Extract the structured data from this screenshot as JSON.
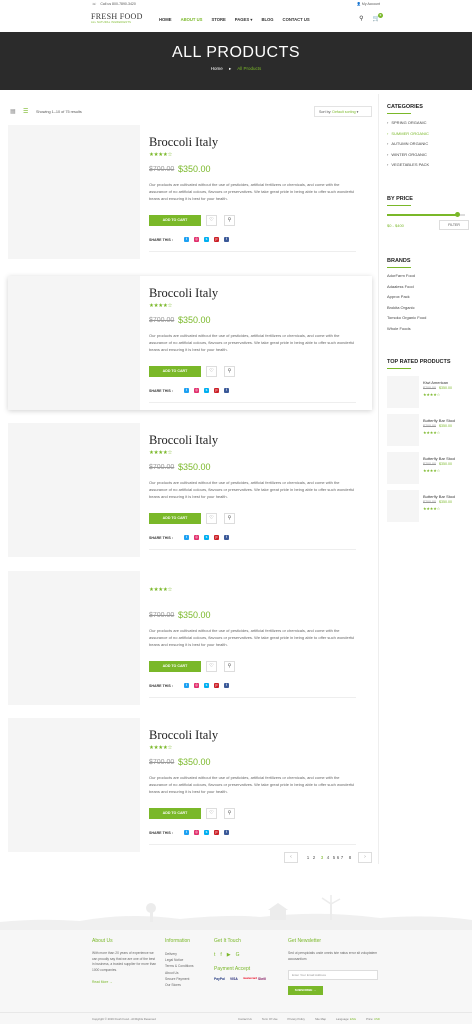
{
  "topbar": {
    "phone": "Call us 800-7890-3420",
    "account": "My Account"
  },
  "header": {
    "logo_main": "FRESH FOOD",
    "logo_sub": "ALL NATURAL INGREDIENTS",
    "nav": [
      "HOME",
      "ABOUT US",
      "STORE",
      "PAGES",
      "BLOG",
      "CONTACT US"
    ],
    "nav_active_index": 1,
    "cart_count": "0"
  },
  "banner": {
    "title": "ALL PRODUCTS",
    "crumb_home": "Home",
    "crumb_sep": "▸",
    "crumb_current": "All Products"
  },
  "toolbar": {
    "results": "Showing 1–10 of 75 results",
    "sort_label": "Sort by:",
    "sort_value": "Default sorting"
  },
  "products": [
    {
      "title": "Broccoli Italy",
      "old_price": "$700.00",
      "new_price": "$350.00",
      "rating": 4.5,
      "stars": "★★★★☆",
      "description": "Our products are cultivated without the use of pesticides, artificial fertilizers or chemicals, and come with the assurance of no artificial colours, flavours or preservatives. We take great pride in being able to offer such wonderful beans and ensuring it is best for your health.",
      "add_to_cart": "ADD TO CART",
      "share": "SHARE THIS :"
    },
    {
      "title": "Broccoli Italy",
      "old_price": "$700.00",
      "new_price": "$350.00",
      "rating": 4.5,
      "stars": "★★★★☆",
      "description": "Our products are cultivated without the use of pesticides, artificial fertilizers or chemicals, and come with the assurance of no artificial colours, flavours or preservatives. We take great pride in being able to offer such wonderful beans and ensuring it is best for your health.",
      "add_to_cart": "ADD TO CART",
      "share": "SHARE THIS :"
    },
    {
      "title": "Broccoli Italy",
      "old_price": "$700.00",
      "new_price": "$350.00",
      "rating": 4.5,
      "stars": "★★★★☆",
      "description": "Our products are cultivated without the use of pesticides, artificial fertilizers or chemicals, and come with the assurance of no artificial colours, flavours or preservatives. We take great pride in being able to offer such wonderful beans and ensuring it is best for your health.",
      "add_to_cart": "ADD TO CART",
      "share": "SHARE THIS :"
    },
    {
      "title": "",
      "old_price": "$700.00",
      "new_price": "$350.00",
      "rating": 4.5,
      "stars": "★★★★☆",
      "description": "Our products are cultivated without the use of pesticides, artificial fertilizers or chemicals, and come with the assurance of no artificial colours, flavours or preservatives. We take great pride in being able to offer such wonderful beans and ensuring it is best for your health.",
      "add_to_cart": "ADD TO CART",
      "share": "SHARE THIS :"
    },
    {
      "title": "Broccoli Italy",
      "old_price": "$700.00",
      "new_price": "$350.00",
      "rating": 4.5,
      "stars": "★★★★☆",
      "description": "Our products are cultivated without the use of pesticides, artificial fertilizers or chemicals, and come with the assurance of no artificial colours, flavours or preservatives. We take great pride in being able to offer such wonderful beans and ensuring it is best for your health.",
      "add_to_cart": "ADD TO CART",
      "share": "SHARE THIS :"
    }
  ],
  "social_icons": [
    "twitter-icon",
    "instagram-icon",
    "skype-icon",
    "pinterest-icon",
    "facebook-icon"
  ],
  "social_colors": [
    "#1da1f2",
    "#e1306c",
    "#00aff0",
    "#cb2027",
    "#3b5998"
  ],
  "pagination": {
    "prev": "‹",
    "pages": [
      "1",
      "2",
      "3",
      "4",
      "5",
      "6",
      "7",
      "8"
    ],
    "active_index": 2,
    "next": "›"
  },
  "sidebar": {
    "categories_title": "CATEGORIES",
    "categories": [
      "SPRING ORGANIC",
      "SUMMER ORGANIC",
      "AUTUMN ORGANIC",
      "WINTER ORGANIC",
      "VEGETABLES PACK"
    ],
    "categories_active_index": 1,
    "price_title": "BY PRICE",
    "price_range": "$0 - $400",
    "price_fill": 0.9,
    "filter_label": "FILTER",
    "brands_title": "BRANDS",
    "brands": [
      "AdorFarm Food",
      "Adaaless Food",
      "Approx Pack",
      "Brokita Organic",
      "Tomoko Organic Food",
      "Whole Foods"
    ],
    "top_rated_title": "TOP RATED PRODUCTS",
    "top_rated": [
      {
        "name": "Kiwi American",
        "old": "$700.00",
        "new": "$350.00",
        "stars": "★★★★☆"
      },
      {
        "name": "Butterfly Bar Stool",
        "old": "$700.00",
        "new": "$350.00",
        "stars": "★★★★☆"
      },
      {
        "name": "Butterfly Bar Stool",
        "old": "$700.00",
        "new": "$350.00",
        "stars": "★★★★☆"
      },
      {
        "name": "Butterfly Bar Stool",
        "old": "$700.00",
        "new": "$350.00",
        "stars": "★★★★☆"
      }
    ]
  },
  "footer": {
    "about_title": "About Us",
    "about_text": "With more than 20 years of experience we can proudly say that we are one of the best in business, a trusted supplier for more than 1000 companies.",
    "read_more": "Read More",
    "info_title": "Information",
    "info_links": [
      "Delivery",
      "Legal Notice",
      "Terms & Conditions",
      "About Us",
      "Secure Payment",
      "Our Stores"
    ],
    "touch_title": "Get It Touch",
    "payment_title": "Payment Accept",
    "payments": [
      "PayPal",
      "VISA",
      "mastercard",
      "Skrill"
    ],
    "newsletter_title": "Get Newsletter",
    "newsletter_text": "Sed ut perspiciatis unde omnis iste natus error sit voluptatem accusantium",
    "email_placeholder": "Enter Your Email Address",
    "subscribe": "SUBSCRIBE",
    "copyright": "Copyright © 2016 Fresh Food - All Rights Reserved",
    "bottom_links": [
      "Contact Us",
      "Term Of Use",
      "Privacy Policy",
      "Site Map"
    ],
    "language_label": "Language:",
    "language_value": "ENG",
    "price_label": "Price:",
    "price_value": "USD"
  }
}
